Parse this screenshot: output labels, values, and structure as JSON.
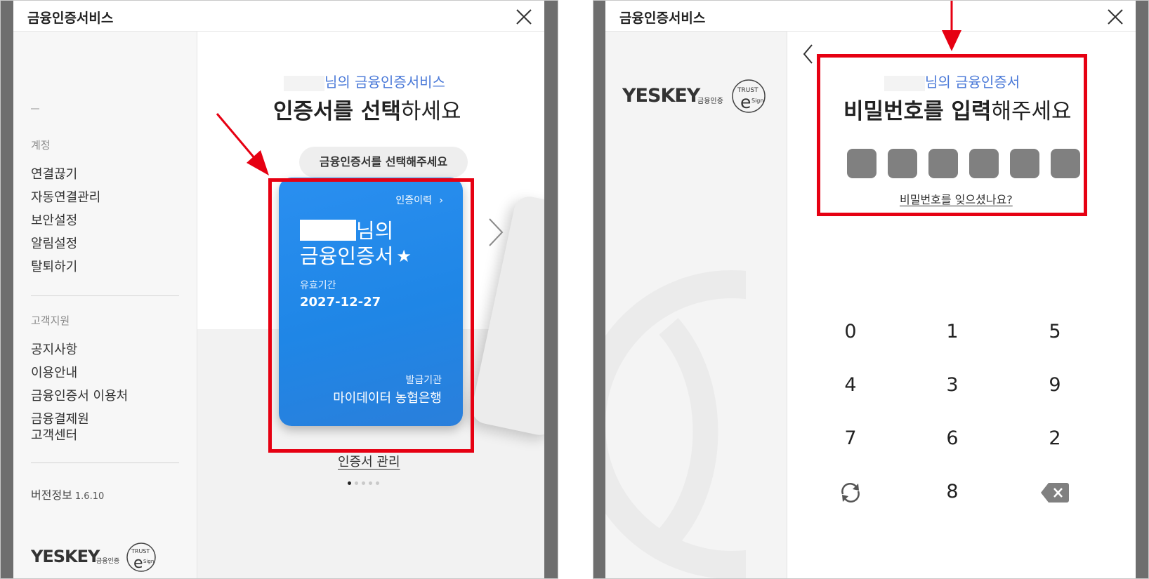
{
  "app_title": "금융인증서비스",
  "colors": {
    "accent": "#4a79d8",
    "card_blue": "#2188ea",
    "highlight_red": "#e60012"
  },
  "left_panel": {
    "title": "금융인증서비스",
    "sidebar": {
      "account_header": "계정",
      "account_items": [
        "연결끊기",
        "자동연결관리",
        "보안설정",
        "알림설정",
        "탈퇴하기"
      ],
      "support_header": "고객지원",
      "support_items": [
        "공지사항",
        "이용안내",
        "금융인증서 이용처",
        "금융결제원",
        "고객센터"
      ],
      "version_label": "버전정보",
      "version_number": "1.6.10",
      "logo_text": "YESKEY",
      "logo_sub": "금융인증",
      "seal_text": "TRUST",
      "seal_letter": "e",
      "seal_sub": "Sign"
    },
    "subtitle": "님의 금융인증서비스",
    "heading_bold": "인증서를 선택",
    "heading_rest": "하세요",
    "select_pill": "금융인증서를 선택해주세요",
    "card": {
      "history_link": "인증이력",
      "owner_suffix": "님의",
      "cert_name": "금융인증서",
      "validity_label": "유효기간",
      "validity_date": "2027-12-27",
      "issuer_label": "발급기관",
      "issuer_name": "마이데이터 농협은행"
    },
    "cert_manage": "인증서 관리",
    "pager": {
      "pages": 5,
      "active": 1
    }
  },
  "right_panel": {
    "title": "금융인증서비스",
    "logo_text": "YESKEY",
    "logo_sub": "금융인증",
    "seal_text": "TRUST",
    "seal_letter": "e",
    "seal_sub": "Sign",
    "subtitle": "님의 금융인증서",
    "heading_bold": "비밀번호를 입력",
    "heading_rest": "해주세요",
    "pin_length": 6,
    "forgot_link": "비밀번호를 잊으셨나요?",
    "keypad": {
      "row1": [
        "0",
        "1",
        "5"
      ],
      "row2": [
        "4",
        "3",
        "9"
      ],
      "row3": [
        "7",
        "6",
        "2"
      ],
      "row4_middle": "8",
      "refresh_icon": "refresh-icon",
      "delete_icon": "backspace-icon"
    }
  }
}
